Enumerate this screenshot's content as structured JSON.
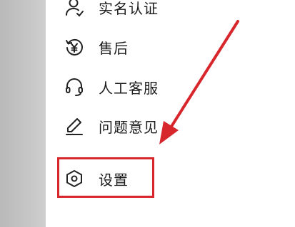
{
  "menu": {
    "items": [
      {
        "label": "实名认证",
        "icon": "user-icon"
      },
      {
        "label": "售后",
        "icon": "yuan-refresh-icon"
      },
      {
        "label": "人工客服",
        "icon": "headset-icon"
      },
      {
        "label": "问题意见",
        "icon": "pencil-icon"
      },
      {
        "label": "设置",
        "icon": "hexagon-gear-icon"
      }
    ]
  },
  "annotation": {
    "color": "#d7262c",
    "highlight_target": "设置"
  }
}
